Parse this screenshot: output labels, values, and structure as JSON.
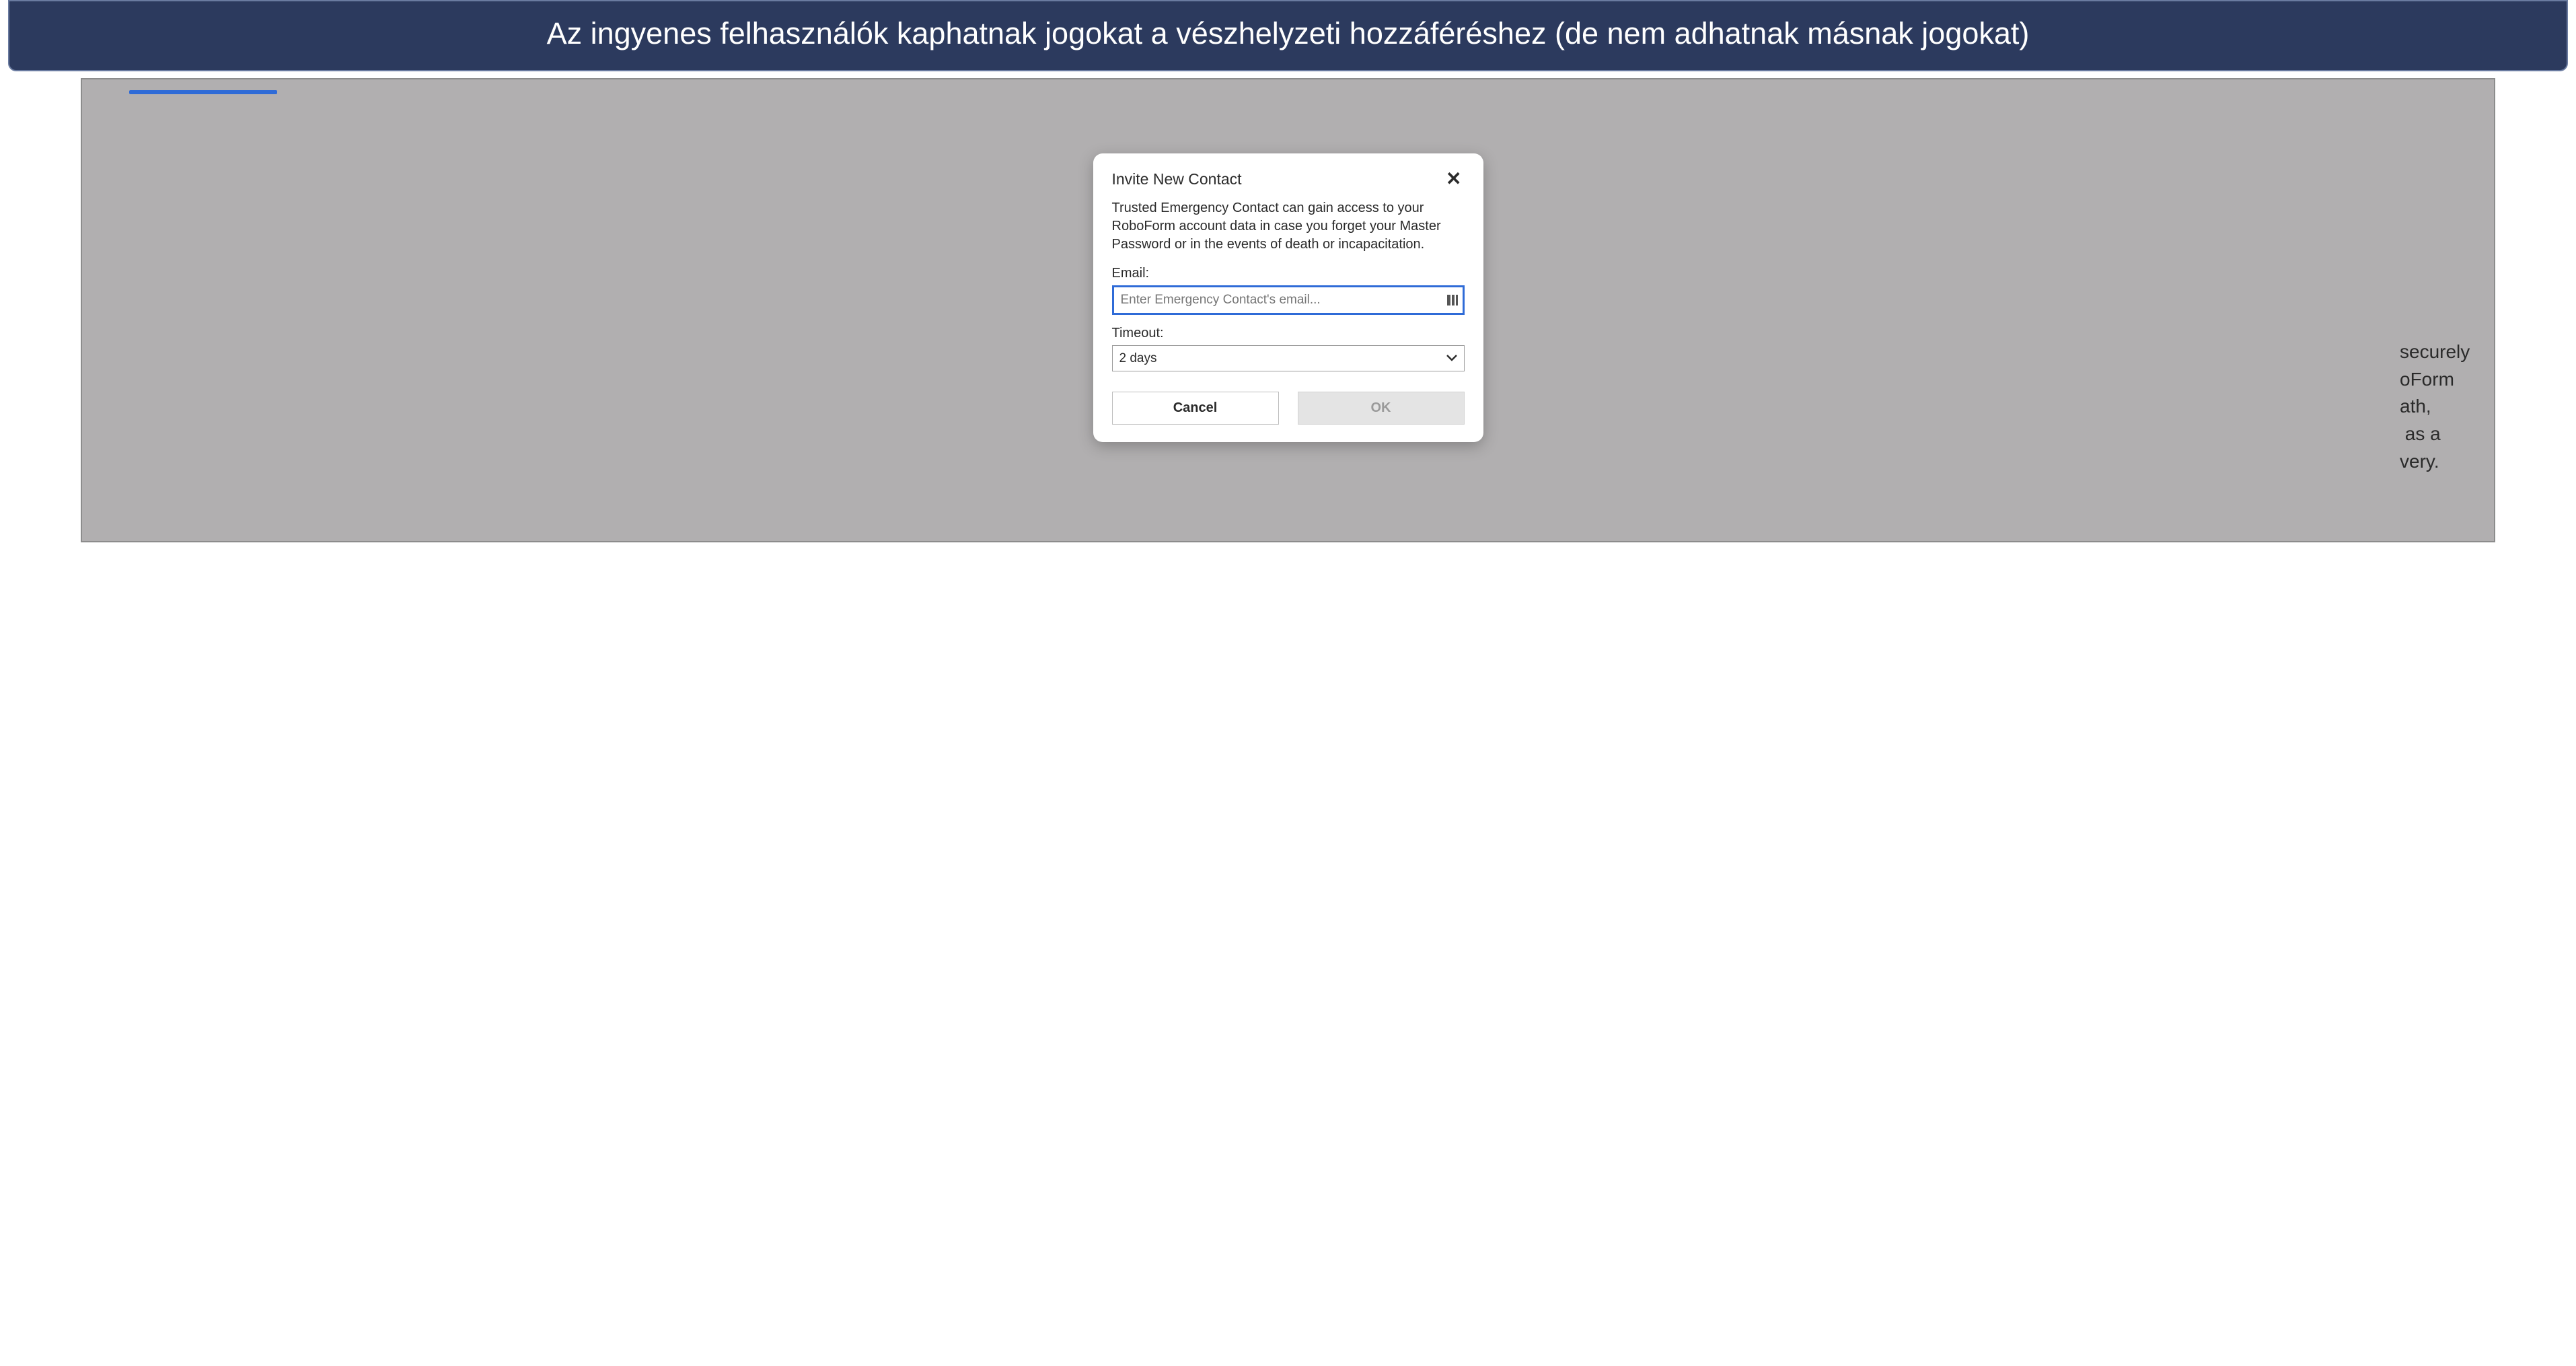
{
  "banner": {
    "text": "Az ingyenes felhasználók kaphatnak jogokat a vészhelyzeti hozzáféréshez (de nem adhatnak másnak jogokat)"
  },
  "background_text_fragment": "securely\noForm\nath,\n as a\nvery.",
  "modal": {
    "title": "Invite New Contact",
    "description": "Trusted Emergency Contact can gain access to your RoboForm account data in case you forget your Master Password or in the events of death or incapacitation.",
    "email_label": "Email:",
    "email_placeholder": "Enter Emergency Contact's email...",
    "email_value": "",
    "timeout_label": "Timeout:",
    "timeout_value": "2 days",
    "cancel_label": "Cancel",
    "ok_label": "OK"
  },
  "colors": {
    "banner_bg": "#2c3a5e",
    "accent_blue": "#2f6bd7",
    "overlay_gray": "#b1afb0"
  }
}
